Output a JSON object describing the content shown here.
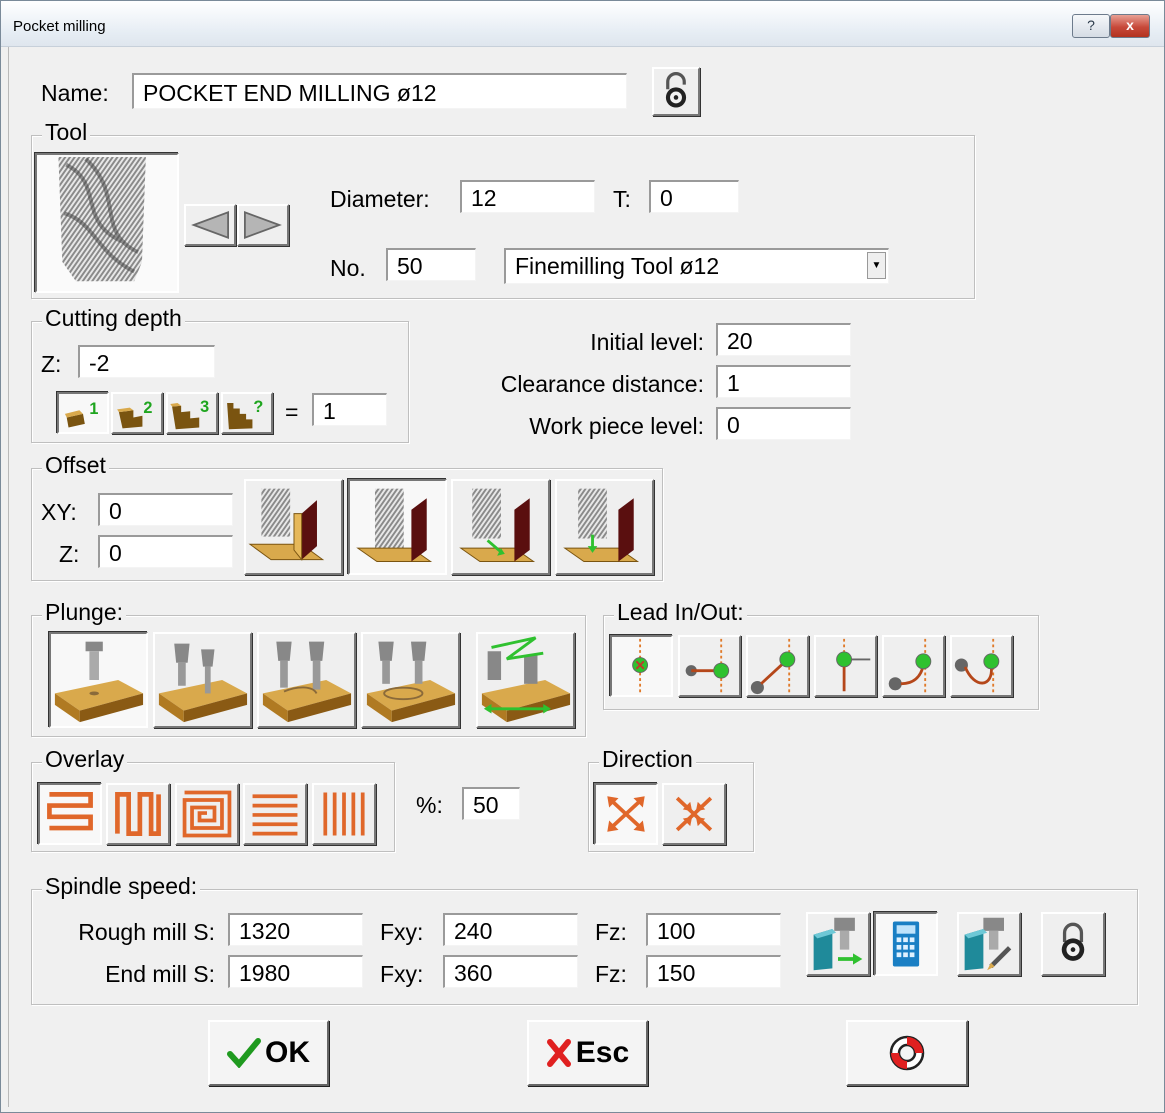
{
  "window": {
    "title": "Pocket milling",
    "help_label": "?",
    "close_label": "x"
  },
  "name": {
    "label": "Name:",
    "value": "POCKET END MILLING  ø12",
    "lock_icon": "padlock-open-icon"
  },
  "tool": {
    "group_label": "Tool",
    "diameter_label": "Diameter:",
    "diameter_value": "12",
    "t_label": "T:",
    "t_value": "0",
    "no_label": "No.",
    "no_value": "50",
    "tool_select_value": "Finemilling Tool ø12"
  },
  "cutting_depth": {
    "group_label": "Cutting depth",
    "z_label": "Z:",
    "z_value": "-2",
    "steps": [
      {
        "icon": "single-step-icon",
        "mark": "1"
      },
      {
        "icon": "two-steps-icon",
        "mark": "2"
      },
      {
        "icon": "three-steps-icon",
        "mark": "3"
      },
      {
        "icon": "custom-steps-icon",
        "mark": "?"
      }
    ],
    "equals": "=",
    "steps_value": "1"
  },
  "levels": {
    "initial_label": "Initial level:",
    "initial_value": "20",
    "clearance_label": "Clearance distance:",
    "clearance_value": "1",
    "workpiece_label": "Work piece level:",
    "workpiece_value": "0"
  },
  "offset": {
    "group_label": "Offset",
    "xy_label": "XY:",
    "xy_value": "0",
    "z_label": "Z:",
    "z_value": "0"
  },
  "plunge": {
    "group_label": "Plunge:"
  },
  "lead": {
    "group_label": "Lead In/Out:"
  },
  "overlay": {
    "group_label": "Overlay",
    "percent_label": "%:",
    "percent_value": "50"
  },
  "direction": {
    "group_label": "Direction"
  },
  "spindle": {
    "group_label": "Spindle speed:",
    "rough_label": "Rough mill S:",
    "rough_s": "1320",
    "rough_fxy_label": "Fxy:",
    "rough_fxy": "240",
    "rough_fz_label": "Fz:",
    "rough_fz": "100",
    "end_label": "End mill S:",
    "end_s": "1980",
    "end_fxy_label": "Fxy:",
    "end_fxy": "360",
    "end_fz_label": "Fz:",
    "end_fz": "150"
  },
  "buttons": {
    "ok_label": "OK",
    "esc_label": "Esc"
  },
  "colors": {
    "accent_orange": "#e0672a",
    "wood": "#d9a94c",
    "green": "#2fc12f"
  }
}
